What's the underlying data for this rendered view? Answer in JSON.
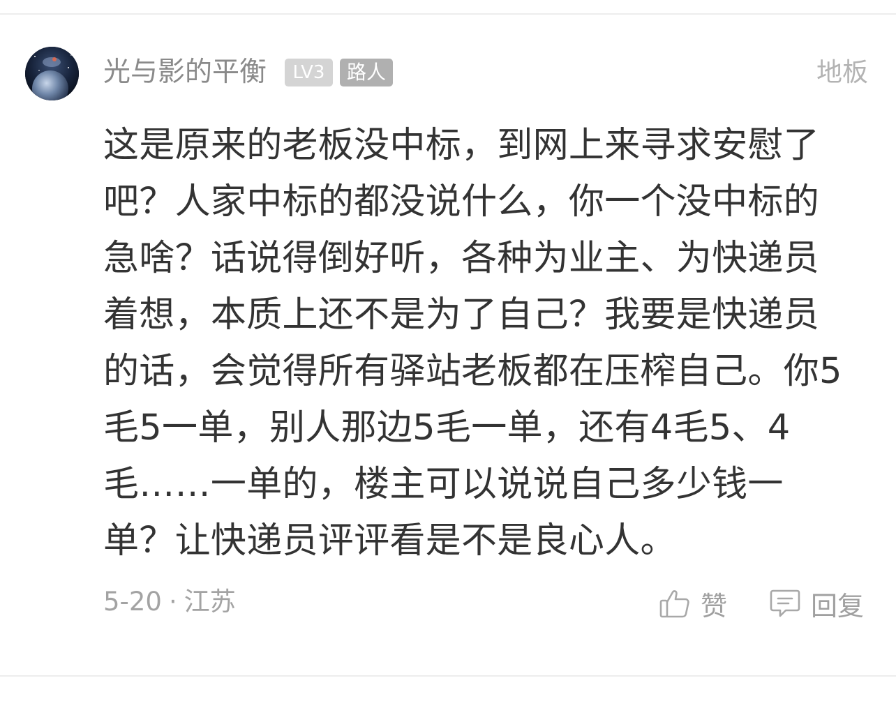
{
  "comment": {
    "user": {
      "name": "光与影的平衡",
      "level": "LV3",
      "role": "路人",
      "avatar_icon": "space-planet-avatar"
    },
    "floor": "地板",
    "text": "这是原来的老板没中标，到网上来寻求安慰了吧？人家中标的都没说什么，你一个没中标的急啥？话说得倒好听，各种为业主、为快递员着想，本质上还不是为了自己？我要是快递员的话，会觉得所有驿站老板都在压榨自己。你5毛5一单，别人那边5毛一单，还有4毛5、4毛……一单的，楼主可以说说自己多少钱一单？让快递员评评看是不是良心人。",
    "date": "5-20",
    "separator": "·",
    "location": "江苏",
    "actions": {
      "like": {
        "label": "赞",
        "icon": "thumbs-up-icon"
      },
      "reply": {
        "label": "回复",
        "icon": "comment-bubble-icon"
      }
    }
  },
  "colors": {
    "text_primary": "#333333",
    "text_secondary": "#8a8a8a",
    "badge_level_bg": "#d4d4d4",
    "badge_role_bg": "#b0b0b0",
    "divider": "#ededed"
  }
}
